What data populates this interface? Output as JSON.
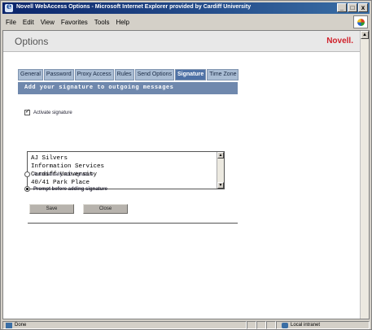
{
  "window": {
    "title": "Novell WebAccess Options - Microsoft Internet Explorer provided by Cardiff University",
    "minimize_glyph": "_",
    "maximize_glyph": "□",
    "close_glyph": "x"
  },
  "menubar": {
    "items": [
      "File",
      "Edit",
      "View",
      "Favorites",
      "Tools",
      "Help"
    ]
  },
  "page": {
    "title": "Options",
    "brand": "Novell."
  },
  "tabs": [
    {
      "label": "General",
      "active": false
    },
    {
      "label": "Password",
      "active": false
    },
    {
      "label": "Proxy Access",
      "active": false
    },
    {
      "label": "Rules",
      "active": false
    },
    {
      "label": "Send Options",
      "active": false
    },
    {
      "label": "Signature",
      "active": true
    },
    {
      "label": "Time Zone",
      "active": false
    }
  ],
  "banner": "Add your signature to outgoing messages",
  "options": {
    "activate_signature": {
      "label": "Activate signature",
      "checked": true
    },
    "automatically_add": {
      "label": "Automatically add signature",
      "selected": false
    },
    "prompt_before": {
      "label": "Prompt before adding signature",
      "selected": true
    }
  },
  "signature_lines": [
    "AJ Silvers",
    "Information Services",
    "Cardiff University",
    "40/41 Park Place"
  ],
  "buttons": {
    "save": "Save",
    "close": "Close"
  },
  "status": {
    "text": "Done",
    "zone": "Local intranet"
  },
  "icons": {
    "scroll_up": "▲",
    "scroll_down": "▼"
  }
}
